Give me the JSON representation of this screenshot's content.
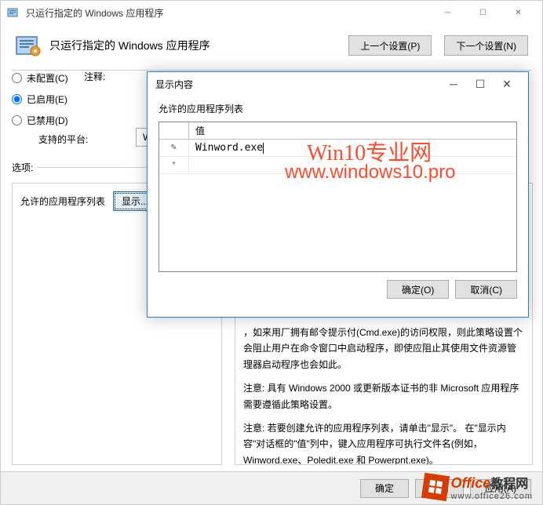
{
  "mainWindow": {
    "title": "只运行指定的 Windows 应用程序",
    "controls": {
      "min": "─",
      "max": "☐",
      "close": "✕"
    }
  },
  "header": {
    "title": "只运行指定的 Windows 应用程序",
    "prevBtn": "上一个设置(P)",
    "nextBtn": "下一个设置(N)"
  },
  "radios": {
    "notConfigured": "未配置(C)",
    "enabled": "已启用(E)",
    "disabled": "已禁用(D)"
  },
  "labels": {
    "comment": "注释:",
    "supported": "支持的平台:",
    "wBoxText": "W",
    "options": "选项:"
  },
  "leftPanel": {
    "listLabel": "允许的应用程序列表",
    "showBtn": "显示..."
  },
  "help": {
    "p1": "，如来用厂拥有邮令提示付(Cmd.exe)的访问权限，则此策略设置个会阻止用户在命令窗口中启动程序，即使应阻止其使用文件资源管理器启动程序也会如此。",
    "p2": "注意: 具有 Windows 2000 或更新版本证书的非 Microsoft 应用程序需要遵循此策略设置。",
    "p3": "注意: 若要创建允许的应用程序列表，请单击\"显示\"。 在\"显示内容\"对话框的\"值\"列中，键入应用程序可执行文件名(例如，Winword.exe、Poledit.exe 和 Powerpnt.exe)。"
  },
  "bottomButtons": {
    "ok": "确定",
    "cancel": "取消",
    "apply": "应用(A)"
  },
  "modal": {
    "title": "显示内容",
    "controls": {
      "min": "─",
      "max": "☐",
      "close": "✕"
    },
    "label": "允许的应用程序列表",
    "columnHeader": "值",
    "rows": [
      {
        "marker": "✎",
        "value": "Winword.exe"
      },
      {
        "marker": "*",
        "value": ""
      }
    ],
    "ok": "确定(O)",
    "cancel": "取消(C)"
  },
  "watermarks": {
    "w1": "Win10专业网",
    "w2": "www.windows10.pro",
    "w3a": "Office",
    "w3b": "教程网",
    "w3c": "www.office26.com"
  }
}
